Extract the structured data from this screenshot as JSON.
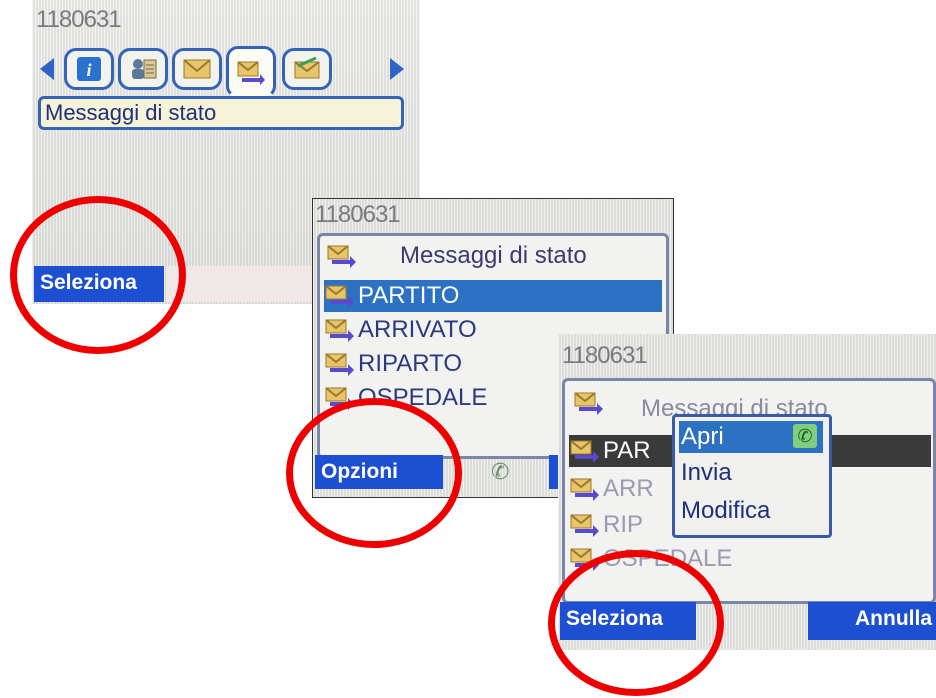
{
  "screen1": {
    "number": "1180631",
    "tabs": [
      "info-icon",
      "phonebook-icon",
      "envelope-icon",
      "status-message-icon",
      "envelope-send-icon"
    ],
    "active_tab": 3,
    "title": "Messaggi di stato",
    "softkey_left": "Seleziona"
  },
  "screen2": {
    "number": "1180631",
    "title": "Messaggi di stato",
    "items": [
      "PARTITO",
      "ARRIVATO",
      "RIPARTO",
      "OSPEDALE"
    ],
    "selected_index": 0,
    "softkey_left": "Opzioni",
    "softkey_mid_icon": "phone-icon"
  },
  "screen3": {
    "number": "1180631",
    "title": "Messaggi di stato",
    "items_partial": [
      "PAR",
      "ARR",
      "RIP",
      "OSPEDALE"
    ],
    "popup": [
      "Apri",
      "Invia",
      "Modifica"
    ],
    "popup_selected_index": 0,
    "softkey_left": "Seleziona",
    "softkey_right": "Annulla"
  },
  "highlight_color": "#ee0000"
}
